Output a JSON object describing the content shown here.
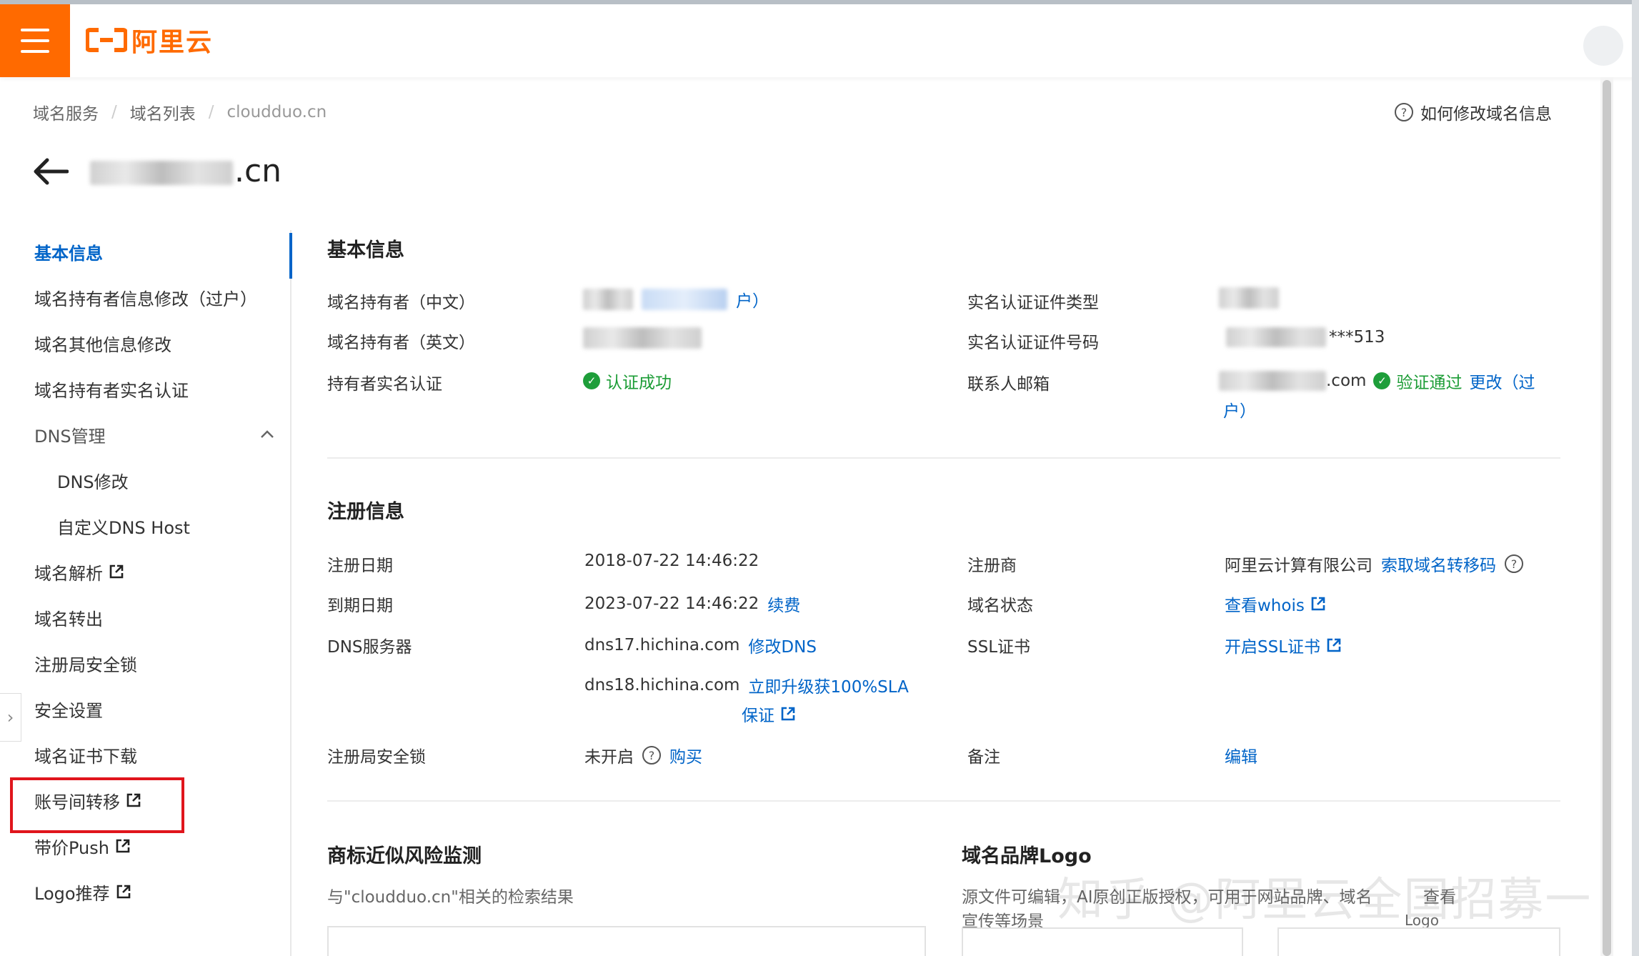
{
  "header": {
    "brand_text": "阿里云",
    "brand_color": "#ff6a00"
  },
  "breadcrumb": {
    "items": [
      "域名服务",
      "域名列表"
    ],
    "current": "cloudduo.cn"
  },
  "help_link": "如何修改域名信息",
  "page_title": ".cn",
  "sidebar": {
    "items": [
      {
        "label": "基本信息"
      },
      {
        "label": "域名持有者信息修改（过户）"
      },
      {
        "label": "域名其他信息修改"
      },
      {
        "label": "域名持有者实名认证"
      },
      {
        "label": "DNS管理"
      },
      {
        "label": "DNS修改"
      },
      {
        "label": "自定义DNS Host"
      },
      {
        "label": "域名解析"
      },
      {
        "label": "域名转出"
      },
      {
        "label": "注册局安全锁"
      },
      {
        "label": "安全设置"
      },
      {
        "label": "域名证书下载"
      },
      {
        "label": "账号间转移"
      },
      {
        "label": "带价Push"
      },
      {
        "label": "Logo推荐"
      }
    ]
  },
  "basic_info": {
    "title": "基本信息",
    "holder_cn_label": "域名持有者（中文）",
    "holder_cn_value_suffix": "户）",
    "holder_en_label": "域名持有者（英文）",
    "realname_label": "持有者实名认证",
    "realname_status": "认证成功",
    "cert_type_label": "实名认证证件类型",
    "cert_no_label": "实名认证证件号码",
    "cert_no_suffix": "***513",
    "email_label": "联系人邮箱",
    "email_suffix": ".com",
    "email_status": "验证通过",
    "email_change": "更改（过",
    "email_change_2": "户）"
  },
  "reg_info": {
    "title": "注册信息",
    "reg_date_label": "注册日期",
    "reg_date": "2018-07-22 14:46:22",
    "exp_date_label": "到期日期",
    "exp_date": "2023-07-22 14:46:22",
    "renew": "续费",
    "dns_label": "DNS服务器",
    "dns1": "dns17.hichina.com",
    "dns_modify": "修改DNS",
    "dns2": "dns18.hichina.com",
    "sla_link_1": "立即升级获100%SLA",
    "sla_link_2": "保证",
    "lock_label": "注册局安全锁",
    "lock_value": "未开启",
    "lock_buy": "购买",
    "registrar_label": "注册商",
    "registrar": "阿里云计算有限公司",
    "transfer_code": "索取域名转移码",
    "status_label": "域名状态",
    "whois": "查看whois",
    "ssl_label": "SSL证书",
    "ssl_link": "开启SSL证书",
    "remark_label": "备注",
    "remark_edit": "编辑"
  },
  "trademark": {
    "title": "商标近似风险监测",
    "desc": "与\"cloudduo.cn\"相关的检索结果"
  },
  "logo_section": {
    "title": "域名品牌Logo",
    "desc": "源文件可编辑，AI原创正版授权，可用于网站品牌、域名",
    "desc_line2": "宣传等场景",
    "link": "查看",
    "link_line2": "Logo"
  },
  "watermark": "知乎 @阿里云全国招募一"
}
